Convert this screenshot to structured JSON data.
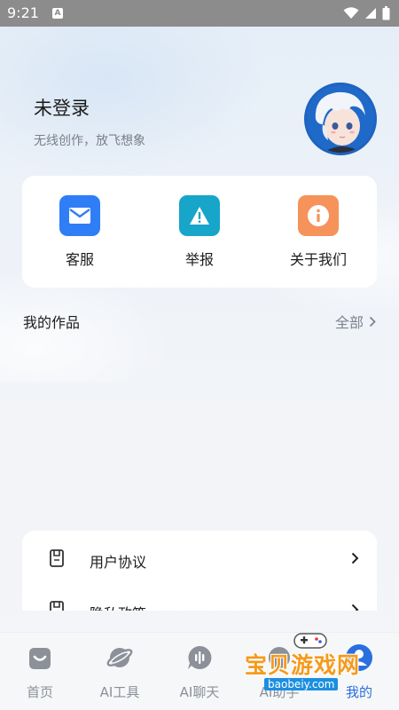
{
  "status_bar": {
    "time": "9:21",
    "notification_letter": "A"
  },
  "profile": {
    "name": "未登录",
    "subtitle": "无线创作，放飞想象"
  },
  "quick_actions": [
    {
      "label": "客服",
      "icon": "mail-icon",
      "color": "#2f7ef5"
    },
    {
      "label": "举报",
      "icon": "warning-icon",
      "color": "#17a5c9"
    },
    {
      "label": "关于我们",
      "icon": "info-icon",
      "color": "#f5935a"
    }
  ],
  "works": {
    "title": "我的作品",
    "view_all": "全部"
  },
  "settings": [
    {
      "label": "用户协议",
      "icon": "document-icon"
    },
    {
      "label": "隐私政策",
      "icon": "privacy-icon"
    }
  ],
  "tabs": [
    {
      "label": "首页",
      "icon": "home-icon",
      "active": false
    },
    {
      "label": "AI工具",
      "icon": "planet-icon",
      "active": false
    },
    {
      "label": "AI聊天",
      "icon": "chat-icon",
      "active": false
    },
    {
      "label": "AI助手",
      "icon": "assistant-icon",
      "active": false
    },
    {
      "label": "我的",
      "icon": "profile-icon",
      "active": true
    }
  ],
  "watermark": {
    "brand": "宝贝游戏网",
    "url": "baobeiy.com"
  },
  "colors": {
    "accent": "#2a6fde",
    "tab_inactive": "#8b9099",
    "status_bar": "#8c8c8c"
  }
}
